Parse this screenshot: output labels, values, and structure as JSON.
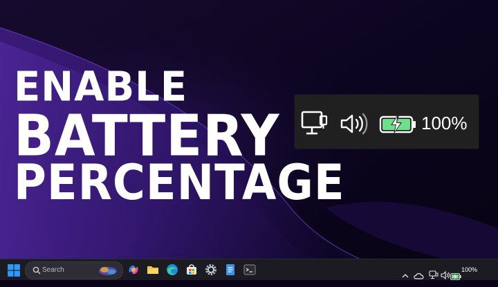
{
  "headline": {
    "line1": "ENABLE",
    "line2": "BATTERY",
    "line3": "PERCENTAGE"
  },
  "tray_zoom": {
    "icons": [
      "network-icon",
      "volume-icon",
      "battery-charging-icon"
    ],
    "battery_percent_label": "100%",
    "battery_level": 1.0,
    "battery_color": "#6fe08a"
  },
  "taskbar": {
    "search_placeholder": "Search",
    "apps": [
      "windows-start-icon",
      "copilot-icon",
      "file-explorer-icon",
      "edge-icon",
      "store-icon",
      "settings-icon",
      "notepad-icon",
      "terminal-icon"
    ],
    "tray_icons": [
      "chevron-up-icon",
      "onedrive-icon",
      "network-icon",
      "volume-icon",
      "battery-charging-icon"
    ],
    "battery_percent_label": "100%"
  },
  "colors": {
    "taskbar_bg": "#1c1b22",
    "tray_panel_bg": "#202020",
    "accent_blue": "#0a84ff"
  }
}
